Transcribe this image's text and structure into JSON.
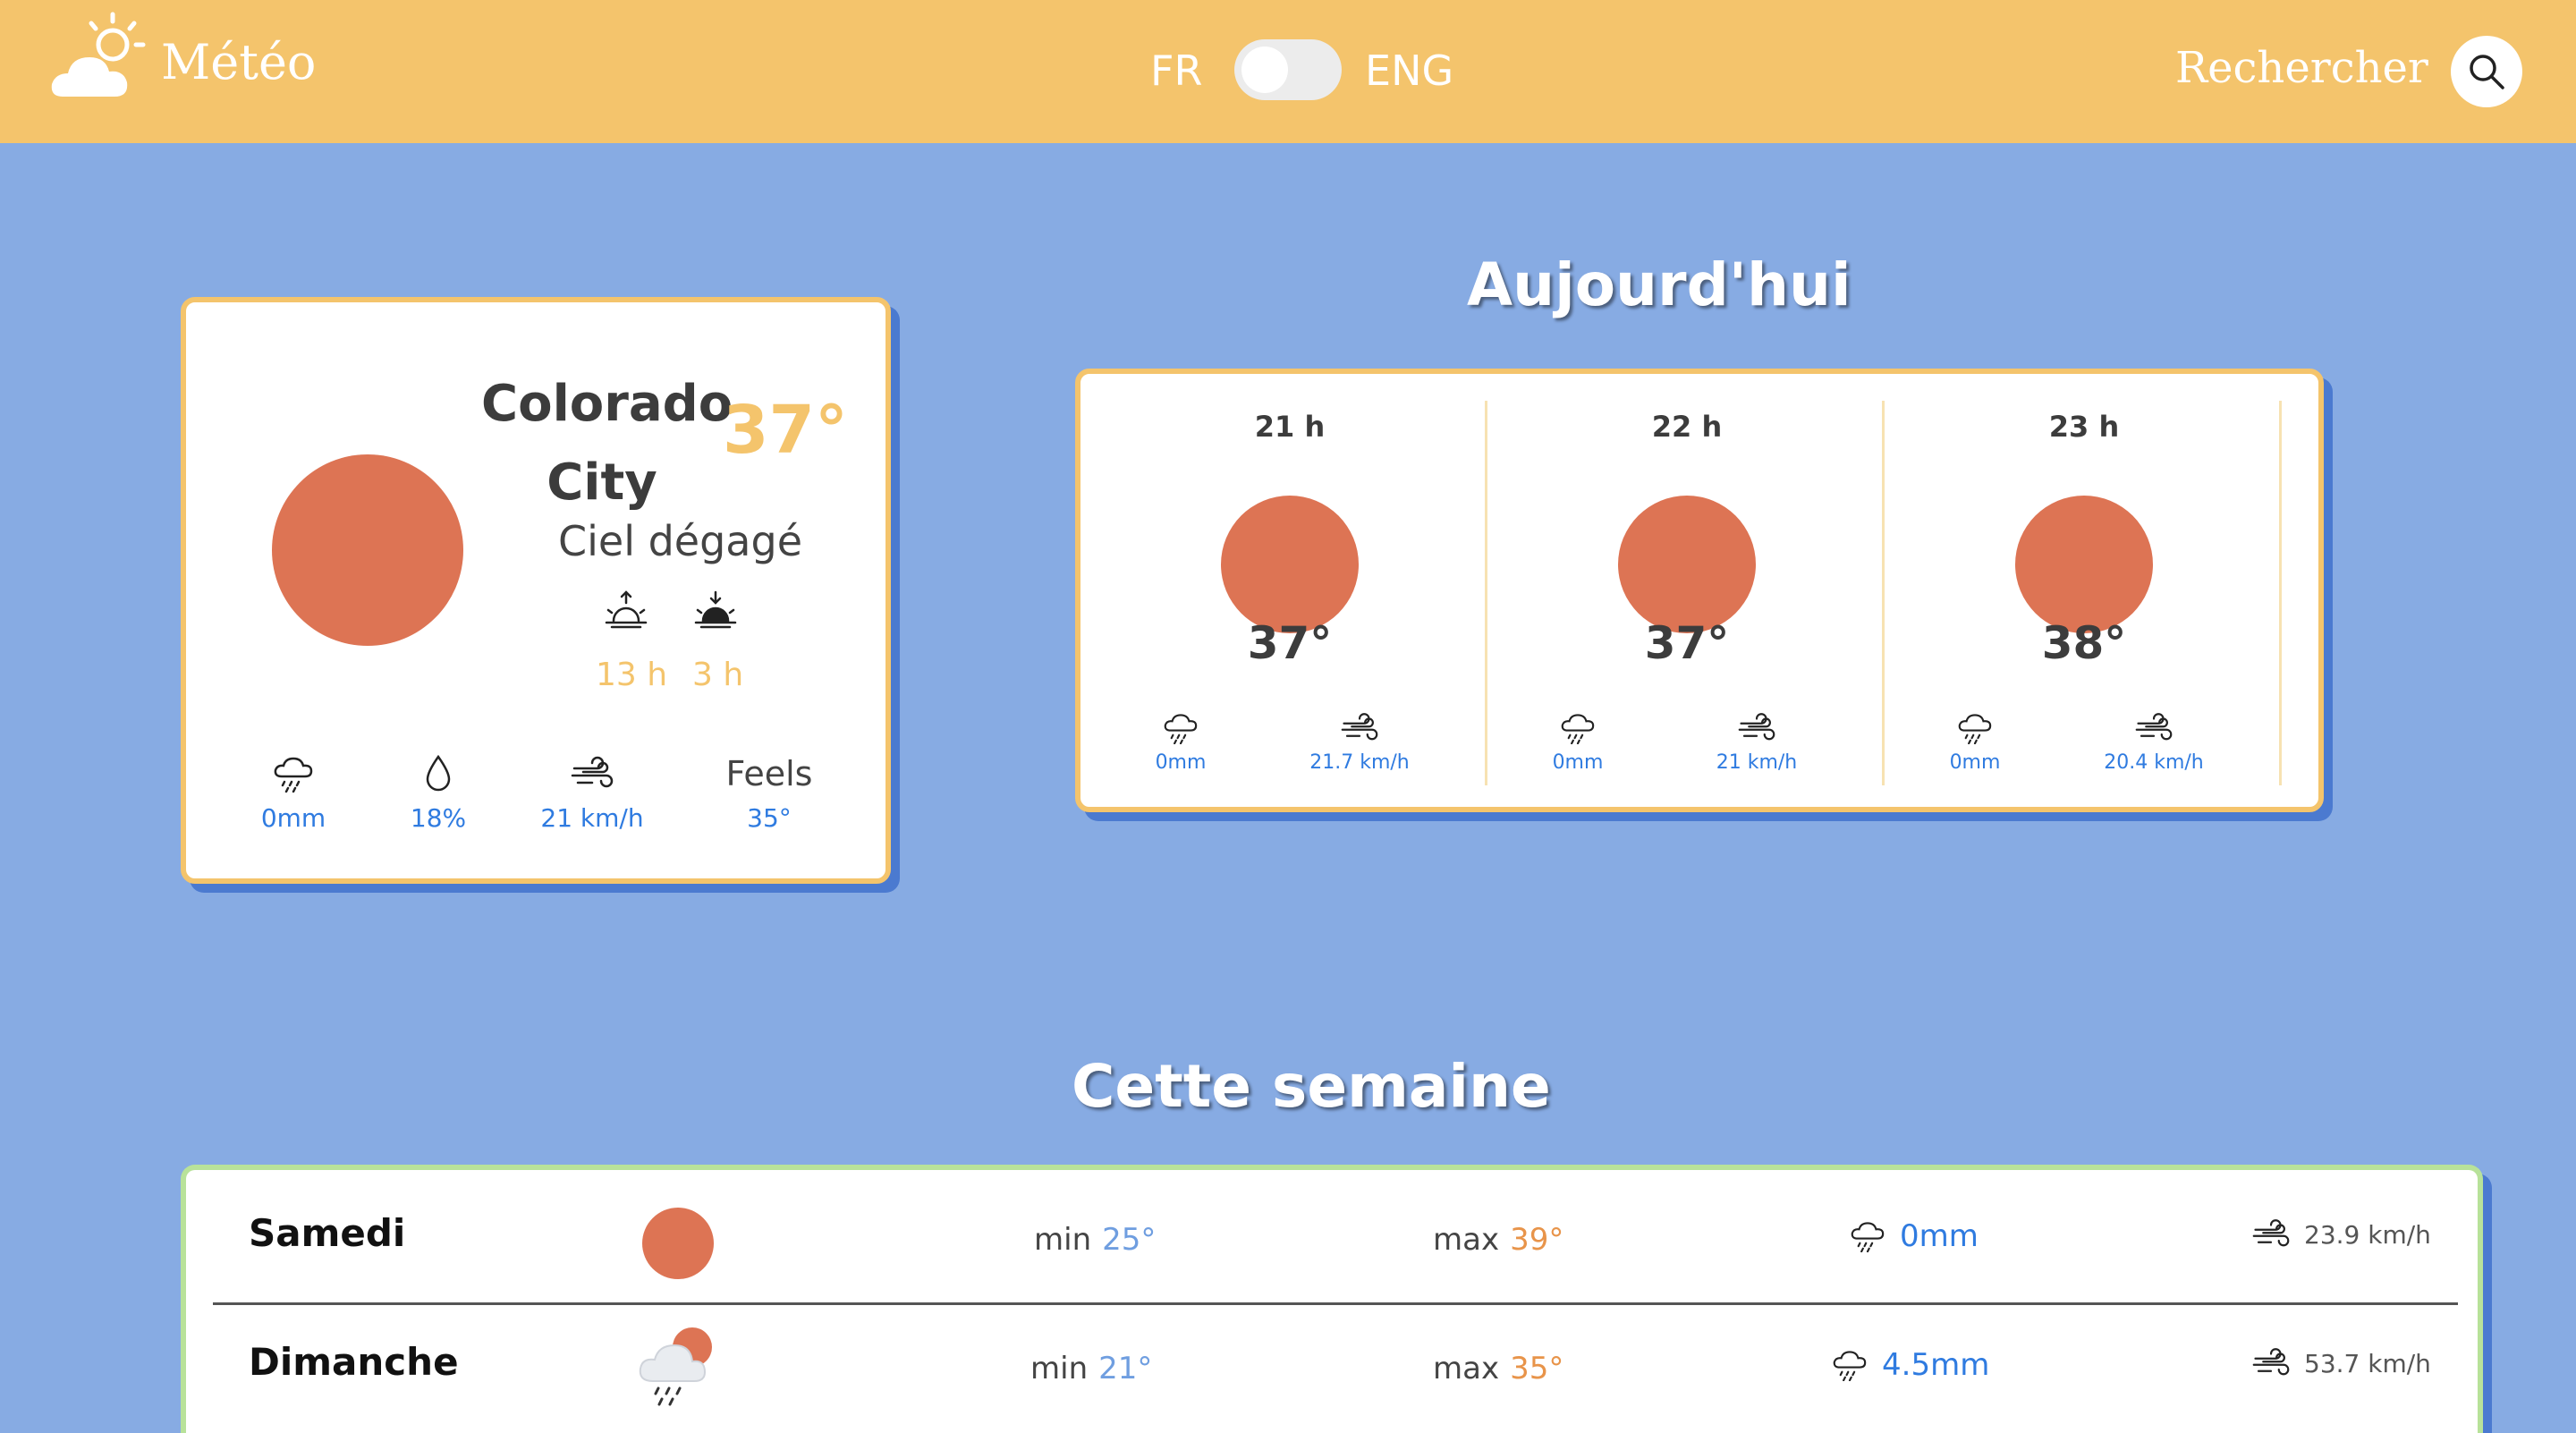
{
  "header": {
    "brand": "Météo",
    "lang_fr": "FR",
    "lang_en": "ENG",
    "search_label": "Rechercher"
  },
  "current": {
    "city": "Colorado City",
    "temp": "37°",
    "condition": "Ciel dégagé",
    "sunrise": "13 h",
    "sunset": "3 h",
    "rain": "0mm",
    "humidity": "18%",
    "wind": "21 km/h",
    "feels_label": "Feels",
    "feels_value": "35°",
    "icon": "sun-icon"
  },
  "today": {
    "title": "Aujourd'hui",
    "hours": [
      {
        "hour": "21 h",
        "temp": "37°",
        "rain": "0mm",
        "wind": "21.7 km/h",
        "icon": "sun-icon"
      },
      {
        "hour": "22 h",
        "temp": "37°",
        "rain": "0mm",
        "wind": "21 km/h",
        "icon": "sun-icon"
      },
      {
        "hour": "23 h",
        "temp": "38°",
        "rain": "0mm",
        "wind": "20.4 km/h",
        "icon": "sun-icon"
      }
    ]
  },
  "week": {
    "title": "Cette semaine",
    "min_label": "min",
    "max_label": "max",
    "days": [
      {
        "day": "Samedi",
        "min": "25°",
        "max": "39°",
        "rain": "0mm",
        "wind": "23.9 km/h",
        "icon": "sun-icon"
      },
      {
        "day": "Dimanche",
        "min": "21°",
        "max": "35°",
        "rain": "4.5mm",
        "wind": "53.7 km/h",
        "icon": "rain-cloud-sun-icon"
      }
    ]
  },
  "colors": {
    "header": "#f4c46c",
    "background": "#87abe3",
    "sun": "#dd7454",
    "accent_value": "#2f7be0"
  }
}
